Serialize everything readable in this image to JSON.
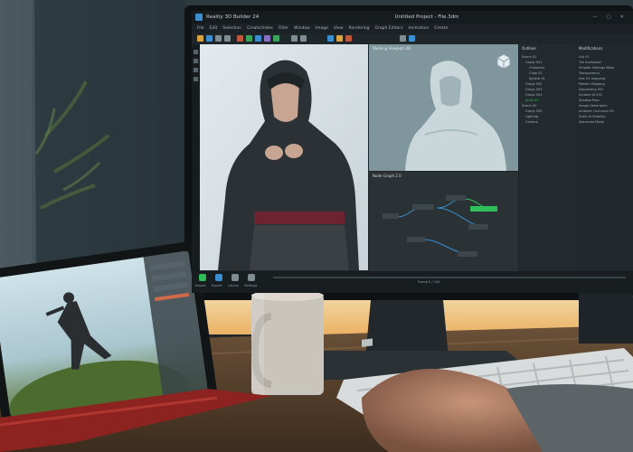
{
  "app": {
    "title": "Reality 3D Builder 24",
    "document": "Untitled Project - File.3dm",
    "window_controls": "— ▢ ✕"
  },
  "menu": [
    "File",
    "Edit",
    "Selection",
    "Create/Index",
    "Filter",
    "Window",
    "Image",
    "View",
    "Rendering",
    "Graph Editors",
    "Animation",
    "Create"
  ],
  "panels": {
    "viewport_3d_title": "Working Viewport 3D",
    "node_graph_title": "Node Graph 2.0",
    "outliner_title": "Outliner",
    "properties_title": "Modifications",
    "outliner_rows": [
      "Scene 01",
      "Group 001",
      "Character",
      "Cube 01",
      "Sphere 01",
      "Group 002",
      "Group 003",
      "Group 004",
      "Anim 01",
      "Scene 02",
      "Group 005",
      "Lighting",
      "Camera"
    ],
    "properties_rows": [
      "List 01",
      "Tile Animation",
      "Smooth Settings Mask",
      "Transparency",
      "Use UV mapping",
      "Pattern Mapping",
      "Inkpainting 001",
      "Surface ID 001",
      "Shadow Pass",
      "Image Generation",
      "Ambient Occlusion Fill",
      "Scale of Visibility",
      "Advanced Mode"
    ]
  },
  "bottom": {
    "labels": [
      "Import",
      "Export",
      "Library",
      "Settings"
    ],
    "timeline": "Frame 0 / 240"
  },
  "colors": {
    "accent": "#3b8ecf",
    "node_highlight": "#2fbf5a",
    "ui_dark": "#1f2529"
  }
}
